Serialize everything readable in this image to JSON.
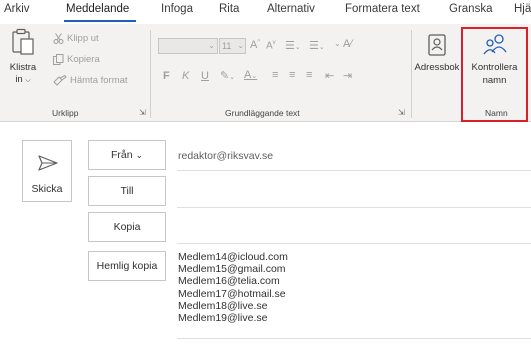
{
  "tabs": [
    "Arkiv",
    "Meddelande",
    "Infoga",
    "Rita",
    "Alternativ",
    "Formatera text",
    "Granska",
    "Hjä"
  ],
  "ribbon": {
    "clipboard": {
      "paste_label_1": "Klistra",
      "paste_label_2": "in",
      "cut": "Klipp ut",
      "copy": "Kopiera",
      "format_painter": "Hämta format",
      "group_label": "Urklipp"
    },
    "basic_text": {
      "font_name": "",
      "font_size": "11",
      "bold": "F",
      "italic": "K",
      "underline": "U",
      "group_label": "Grundläggande text"
    },
    "names": {
      "address_book": "Adressbok",
      "check_names_1": "Kontrollera",
      "check_names_2": "namn",
      "group_label": "Namn"
    }
  },
  "compose": {
    "send_label": "Skicka",
    "from_label": "Från",
    "from_value": "redaktor@riksvav.se",
    "to_label": "Till",
    "cc_label": "Kopia",
    "bcc_label": "Hemlig kopia",
    "bcc_recipients": [
      "Medlem14@icloud.com",
      "Medlem15@gmail.com",
      "Medlem16@telia.com",
      "Medlem17@hotmail.se",
      "Medlem18@live.se",
      "Medlem19@live.se"
    ]
  },
  "colors": {
    "accent": "#1f5fb9",
    "highlight": "#d6202b"
  }
}
